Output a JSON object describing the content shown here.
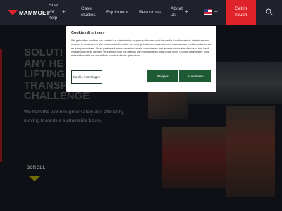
{
  "header": {
    "logo_text": "MAMMOET",
    "nav": [
      {
        "label_lines": [
          "How",
          "we",
          "help"
        ],
        "has_plus": true
      },
      {
        "label_lines": [
          "Case",
          "studies"
        ],
        "has_plus": false
      },
      {
        "label_lines": [
          "Equipment"
        ],
        "has_plus": false
      },
      {
        "label_lines": [
          "Resources"
        ],
        "has_plus": false
      },
      {
        "label_lines": [
          "About",
          "us"
        ],
        "has_plus": true
      }
    ],
    "plus_glyph": "+",
    "language_flag": "us-flag-icon",
    "cta_lines": [
      "Get in",
      "Touch"
    ],
    "search_icon": "search-icon"
  },
  "hero": {
    "title_lines": [
      "SOLUTI",
      "ANY HE",
      "LIFTING",
      "TRANSP",
      "CHALLENGE"
    ],
    "subtitle": "We help the world to grow safely and efficiently, moving towards a sustainable future.",
    "scroll_label": "SCROLL"
  },
  "cookie": {
    "title": "Cookies & privacy",
    "body": "We gebruiken cookies om content en advertenties te personaliseren, sociale media-functies aan te bieden en ons verkeer te analyseren. We delen ook informatie over uw gebruik van onze site met onze sociale media-, advertentie- en analysepartners. Deze partners kunnen deze informatie combineren met andere informatie die u aan hen heeft verstrekt of die zij hebben verzameld door uw gebruik van hun diensten. Klik op de knop 'Cookie-instellingen' voor meer informatie en om zelf uw cookies die we gebruiken.",
    "settings_label": "Cookie-instellingen",
    "reject_label": "Afwijzen",
    "accept_label": "Accepteren"
  },
  "colors": {
    "brand_red": "#e0232b",
    "cookie_button_green": "#1e5a34",
    "scroll_arrow": "#d4c60e"
  }
}
